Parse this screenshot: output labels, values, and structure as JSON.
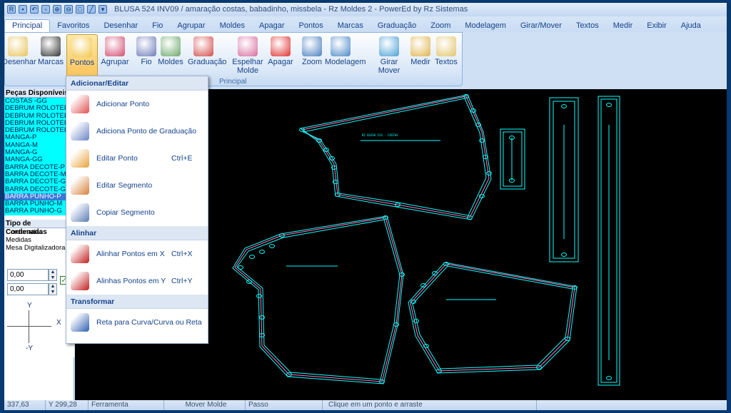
{
  "window": {
    "title": "BLUSA 524 INV09 / amaração costas, babadinho, missbela - Rz Moldes 2 - PowerEd by Rz Sistemas"
  },
  "tabs": [
    "Principal",
    "Favoritos",
    "Desenhar",
    "Fio",
    "Agrupar",
    "Moldes",
    "Apagar",
    "Pontos",
    "Marcas",
    "Graduação",
    "Zoom",
    "Modelagem",
    "Girar/Mover",
    "Textos",
    "Medir",
    "Exibir",
    "Ajuda"
  ],
  "ribbon": {
    "group_label": "Principal",
    "buttons": [
      "Desenhar",
      "Marcas",
      "Pontos",
      "Agrupar",
      "Fio",
      "Moldes",
      "Graduação",
      "Espelhar Molde",
      "Apagar",
      "Zoom",
      "Modelagem",
      "Girar Mover",
      "Medir",
      "Textos"
    ]
  },
  "left_panel": {
    "pieces_header": "Peças Disponíveis",
    "pieces": [
      "COSTAS -GG",
      "DEBRUM ROLOTEE",
      "DEBRUM ROLOTEE",
      "DEBRUM ROLOTEE",
      "DEBRUM ROLOTEE",
      "MANGA-P",
      "MANGA-M",
      "MANGA-G",
      "MANGA-GG",
      "BARRA DECOTE-P",
      "BARRA DECOTE-M",
      "BARRA DECOTE-G",
      "BARRA DECOTE-GG",
      "BARRA PUNHO-P",
      "BARRA PUNHO-M",
      "BARRA PUNHO-G"
    ],
    "selected_piece": "BARRA PUNHO-P",
    "coord_header": "Tipo de Cordenadas",
    "coord_types": [
      "Cordenadas",
      "Medidas",
      "Mesa Digitalizadora"
    ],
    "x_value": "0,00",
    "y_value": "0,00",
    "axis_y": "Y",
    "axis_x": "X",
    "axis_neg_y": "-Y"
  },
  "menu": {
    "section1": "Adicionar/Editar",
    "items1": [
      {
        "label": "Adicionar Ponto",
        "shortcut": ""
      },
      {
        "label": "Adiciona Ponto de Graduação",
        "shortcut": ""
      },
      {
        "label": "Editar Ponto",
        "shortcut": "Ctrl+E"
      },
      {
        "label": "Editar Segmento",
        "shortcut": ""
      },
      {
        "label": "Copiar Segmento",
        "shortcut": ""
      }
    ],
    "section2": "Alinhar",
    "items2": [
      {
        "label": "Alinhar Pontos em X",
        "shortcut": "Ctrl+X"
      },
      {
        "label": "Alinhas Pontos em Y",
        "shortcut": "Ctrl+Y"
      }
    ],
    "section3": "Transformar",
    "items3": [
      {
        "label": "Reta para Curva/Curva ou Reta",
        "shortcut": ""
      }
    ]
  },
  "status": {
    "x": "337,63",
    "y": "Y 299,28",
    "tool_label": "Ferramenta",
    "tool": "Mover Molde",
    "step_label": "Passo",
    "hint": "Clique em um ponto e arraste"
  },
  "colors": {
    "cyan": "#00ffff",
    "pink": "#ff7ac8",
    "ribbon_selected": "#fbc45b"
  }
}
